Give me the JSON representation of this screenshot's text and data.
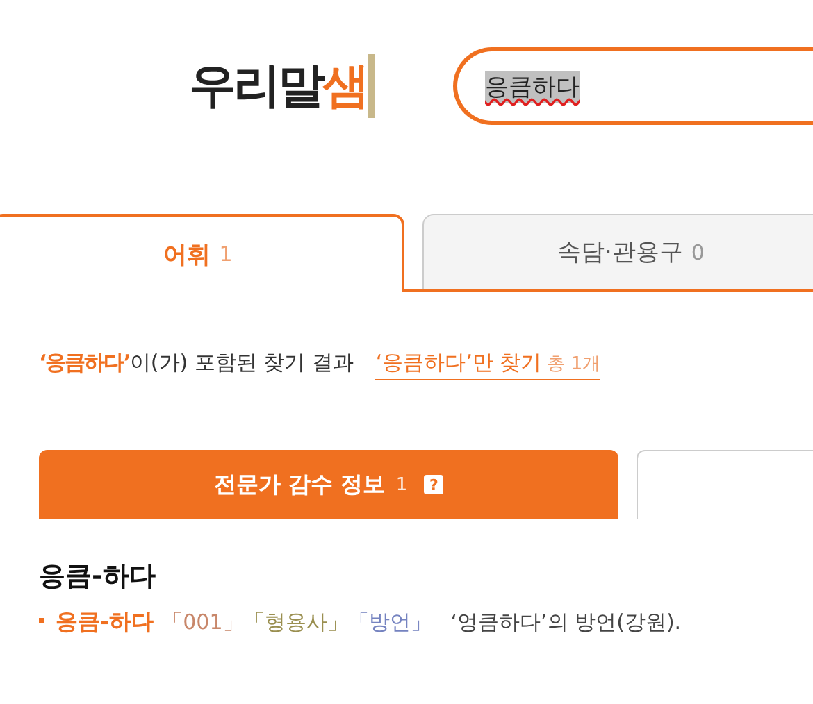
{
  "logo": {
    "text": "우리말",
    "accent": "샘"
  },
  "search": {
    "value": "응큼하다",
    "selected": true,
    "misspelled": true
  },
  "tabs": [
    {
      "label": "어휘",
      "count": "1",
      "selected": true
    },
    {
      "label": "속담·관용구",
      "count": "0",
      "selected": false
    }
  ],
  "summary": {
    "term": "‘응큼하다’",
    "text": "이(가) 포함된 찾기 결과",
    "link": "‘응큼하다’만 찾기",
    "link_count": "총 1개"
  },
  "sub_tabs": [
    {
      "label": "전문가 감수 정보",
      "count": "1",
      "help": "?",
      "selected": true
    },
    {
      "selected": false
    }
  ],
  "entry": {
    "headword": "응큼-하다",
    "senses": [
      {
        "word": "응큼-하다",
        "tags": [
          {
            "text": "「001」",
            "color": "#c8876a"
          },
          {
            "text": "「형용사」",
            "color": "#9a8f50"
          },
          {
            "text": "「방언」",
            "color": "#7583c0"
          }
        ],
        "definition": "‘엉큼하다’의 방언(강원)."
      }
    ]
  }
}
